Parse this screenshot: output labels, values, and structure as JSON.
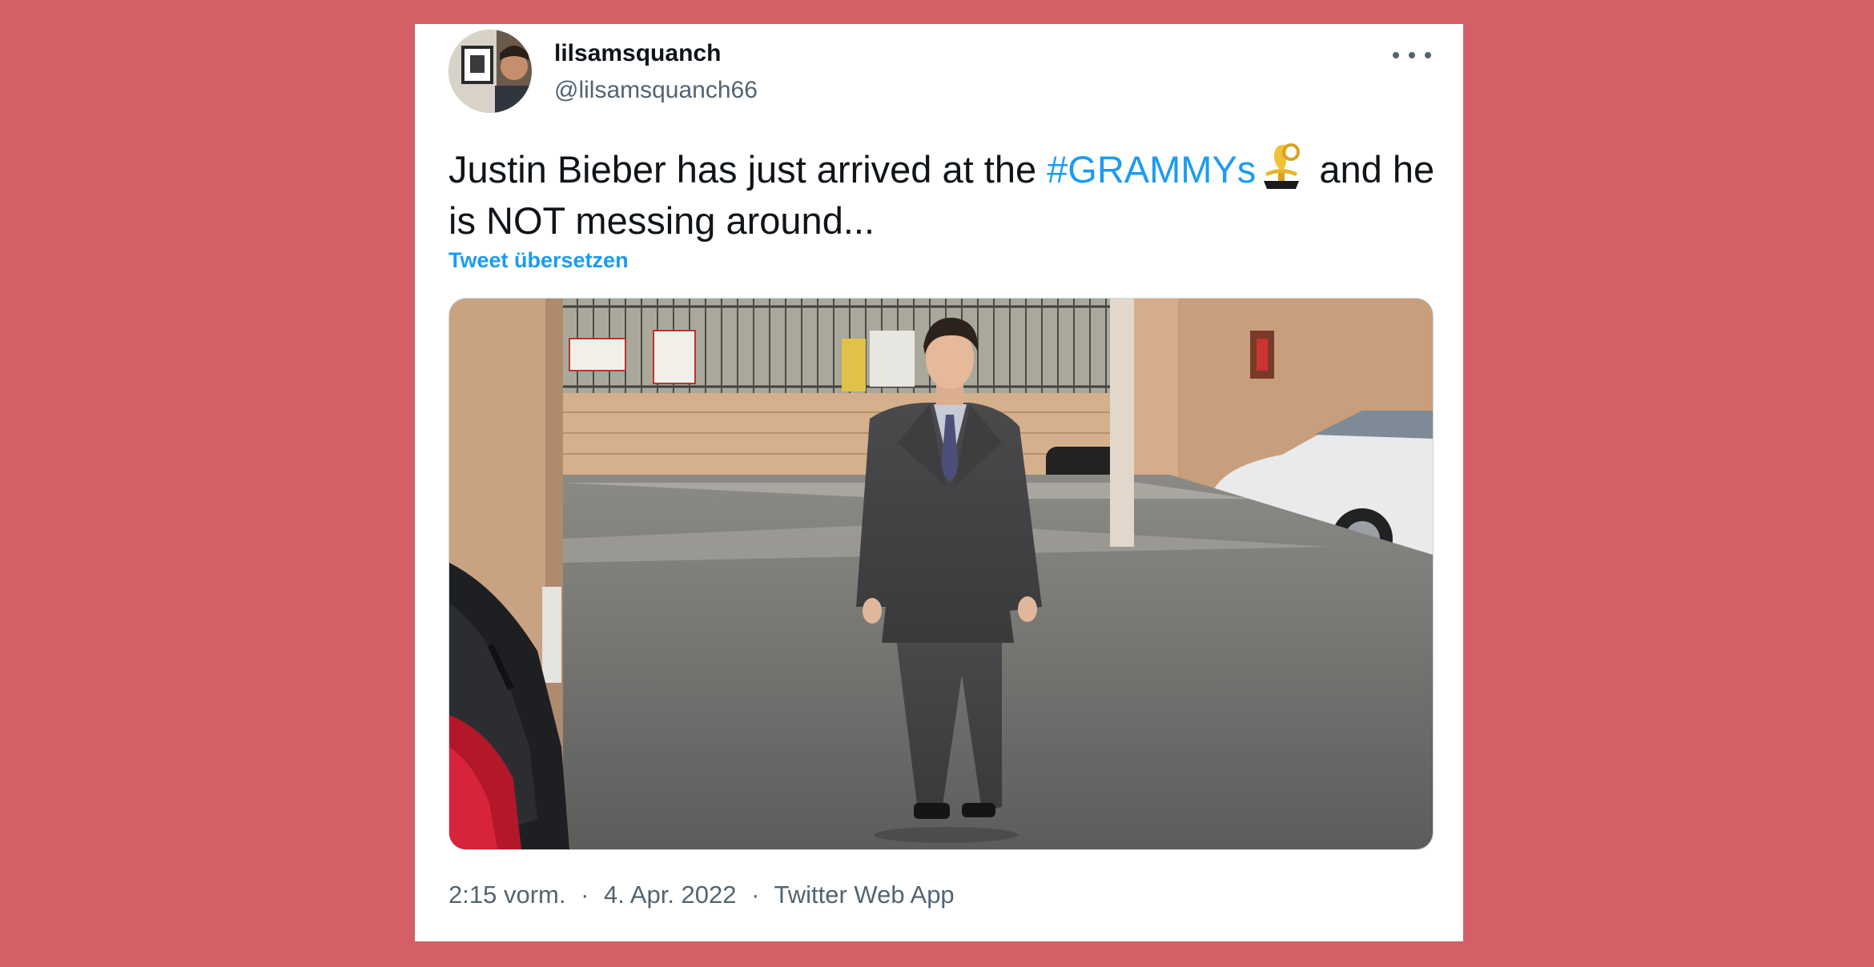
{
  "tweet": {
    "author": {
      "display_name": "lilsamsquanch",
      "handle": "@lilsamsquanch66",
      "avatar_icon": "avatar-photo"
    },
    "text_before": "Justin Bieber has just arrived at the ",
    "hashtag": "#GRAMMYs",
    "emoji_icon": "grammy-trophy-icon",
    "text_after": " and he is NOT messing around...",
    "translate_label": "Tweet übersetzen",
    "media_icon": "tweet-photo",
    "footer": {
      "time": "2:15 vorm.",
      "separator": "·",
      "date": "4. Apr. 2022",
      "source": "Twitter Web App"
    },
    "more_icon": "more-options-icon"
  },
  "colors": {
    "background": "#d45f66",
    "card": "#ffffff",
    "link": "#1d9bf0",
    "text": "#0f1419",
    "muted": "#536471"
  }
}
